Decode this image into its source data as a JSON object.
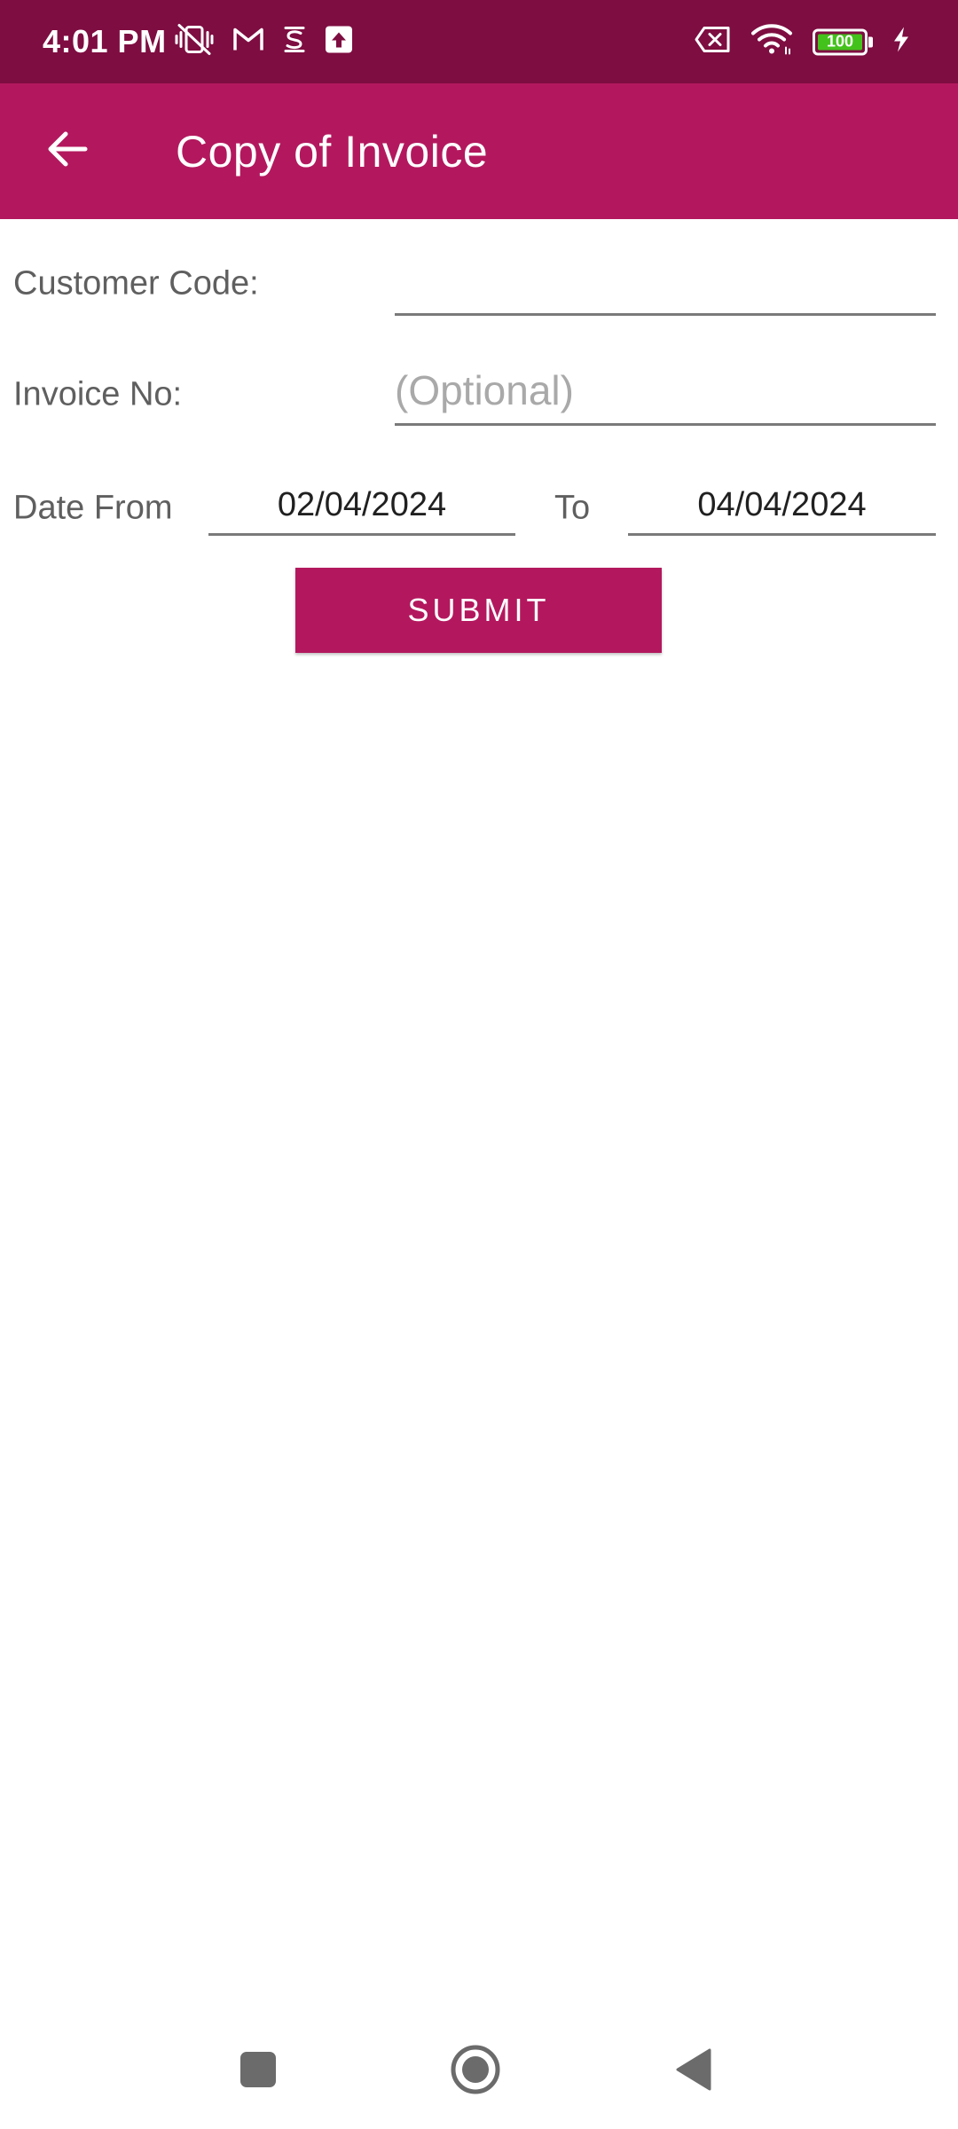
{
  "status_bar": {
    "time": "4:01 PM",
    "battery_level": "100",
    "battery_fraction": 1.0,
    "background": "#7E0D41",
    "icons_left": [
      "vibrate-off-icon",
      "gmail-icon",
      "s-app-icon",
      "upload-icon"
    ],
    "icons_right": [
      "no-sim-icon",
      "wifi-icon",
      "battery-icon",
      "charging-icon"
    ]
  },
  "app_bar": {
    "title": "Copy of Invoice",
    "background": "#B3185E",
    "back_icon": "arrow-back-icon"
  },
  "form": {
    "customer_code": {
      "label": "Customer Code:",
      "value": "",
      "placeholder": ""
    },
    "invoice_no": {
      "label": "Invoice No:",
      "value": "",
      "placeholder": "(Optional)"
    },
    "date_from": {
      "label": "Date From",
      "value": "02/04/2024"
    },
    "date_to": {
      "label": "To",
      "value": "04/04/2024"
    },
    "submit_label": "SUBMIT"
  },
  "nav_bar": {
    "icons": [
      "recents-square-icon",
      "home-circle-icon",
      "back-triangle-icon"
    ]
  }
}
